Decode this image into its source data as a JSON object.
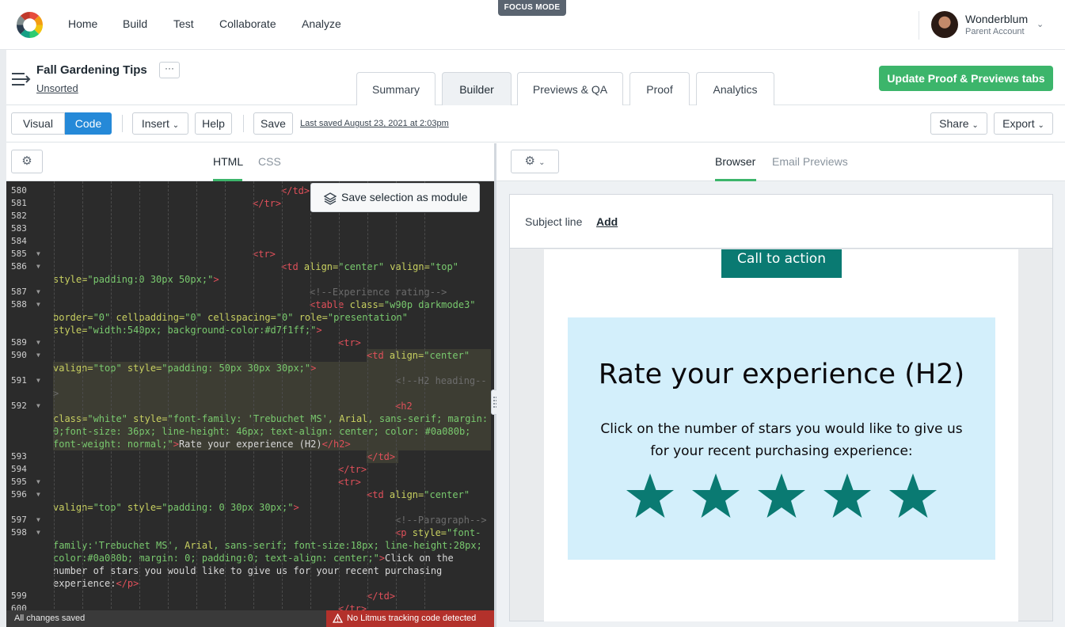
{
  "topnav": {
    "items": [
      "Home",
      "Build",
      "Test",
      "Collaborate",
      "Analyze"
    ],
    "focus_mode": "FOCUS MODE",
    "account": {
      "name": "Wonderblum",
      "role": "Parent Account"
    }
  },
  "project": {
    "title": "Fall Gardening Tips",
    "more_label": "···",
    "folder": "Unsorted",
    "tabs": [
      "Summary",
      "Builder",
      "Previews & QA",
      "Proof",
      "Analytics"
    ],
    "active_tab": "Builder",
    "update_button": "Update Proof & Previews tabs"
  },
  "toolbar": {
    "visual": "Visual",
    "code": "Code",
    "insert": "Insert",
    "help": "Help",
    "save": "Save",
    "last_saved": "Last saved August 23, 2021 at 2:03pm",
    "share": "Share",
    "export": "Export"
  },
  "editor": {
    "tabs": [
      "HTML",
      "CSS"
    ],
    "active_tab": "HTML",
    "save_selection": "Save selection as module",
    "status": "All changes saved",
    "warning": "No Litmus tracking code detected",
    "lines": [
      {
        "num": "580",
        "fold": false,
        "indent": 347,
        "segs": [
          {
            "c": "tg",
            "t": "</td>"
          }
        ]
      },
      {
        "num": "581",
        "fold": false,
        "indent": 311,
        "segs": [
          {
            "c": "tg",
            "t": "</tr>"
          }
        ]
      },
      {
        "num": "582",
        "fold": false,
        "indent": 0,
        "segs": []
      },
      {
        "num": "583",
        "fold": false,
        "indent": 0,
        "segs": []
      },
      {
        "num": "584",
        "fold": false,
        "indent": 0,
        "segs": []
      },
      {
        "num": "585",
        "fold": true,
        "indent": 311,
        "segs": [
          {
            "c": "tg",
            "t": "<tr>"
          }
        ]
      },
      {
        "num": "586",
        "fold": true,
        "indent": 347,
        "segs": [
          {
            "c": "tg",
            "t": "<td "
          },
          {
            "c": "at",
            "t": "align="
          },
          {
            "c": "sv",
            "t": "\"center\""
          },
          {
            "c": "at",
            "t": " valign="
          },
          {
            "c": "sv",
            "t": "\"top\""
          }
        ]
      },
      {
        "num": "",
        "fold": false,
        "indent": 59,
        "segs": [
          {
            "c": "at",
            "t": "style="
          },
          {
            "c": "sv",
            "t": "\"padding:0 30px 50px;\""
          },
          {
            "c": "tg",
            "t": ">"
          }
        ]
      },
      {
        "num": "587",
        "fold": true,
        "indent": 383,
        "segs": [
          {
            "c": "cm",
            "t": "<!--Experience rating-->"
          }
        ]
      },
      {
        "num": "588",
        "fold": true,
        "indent": 383,
        "segs": [
          {
            "c": "tg",
            "t": "<table "
          },
          {
            "c": "at",
            "t": "class="
          },
          {
            "c": "sv",
            "t": "\"w90p darkmode3\""
          }
        ]
      },
      {
        "num": "",
        "fold": false,
        "indent": 59,
        "segs": [
          {
            "c": "at",
            "t": "border="
          },
          {
            "c": "sv",
            "t": "\"0\""
          },
          {
            "c": "at",
            "t": " cellpadding="
          },
          {
            "c": "sv",
            "t": "\"0\""
          },
          {
            "c": "at",
            "t": " cellspacing="
          },
          {
            "c": "sv",
            "t": "\"0\""
          },
          {
            "c": "at",
            "t": " role="
          },
          {
            "c": "sv",
            "t": "\"presentation\""
          }
        ]
      },
      {
        "num": "",
        "fold": false,
        "indent": 59,
        "segs": [
          {
            "c": "at",
            "t": "style="
          },
          {
            "c": "sv",
            "t": "\"width:540px; background-color:#d7f1ff;\""
          },
          {
            "c": "tg",
            "t": ">"
          }
        ]
      },
      {
        "num": "589",
        "fold": true,
        "indent": 419,
        "segs": [
          {
            "c": "tg",
            "t": "<tr>"
          }
        ]
      },
      {
        "num": "590",
        "fold": true,
        "indent": 455,
        "segs": [
          {
            "c": "tg",
            "t": "<td "
          },
          {
            "c": "at",
            "t": "align="
          },
          {
            "c": "sv",
            "t": "\"center\""
          }
        ]
      },
      {
        "num": "",
        "fold": false,
        "indent": 59,
        "segs": [
          {
            "c": "at",
            "t": "valign="
          },
          {
            "c": "sv",
            "t": "\"top\""
          },
          {
            "c": "at",
            "t": " style="
          },
          {
            "c": "sv",
            "t": "\"padding: 50px 30px 30px;\""
          },
          {
            "c": "tg",
            "t": ">"
          }
        ]
      },
      {
        "num": "591",
        "fold": true,
        "indent": 491,
        "segs": [
          {
            "c": "cm",
            "t": "<!--H2 heading--"
          }
        ]
      },
      {
        "num": "",
        "fold": false,
        "indent": 59,
        "segs": [
          {
            "c": "cm",
            "t": ">"
          }
        ]
      },
      {
        "num": "592",
        "fold": true,
        "indent": 491,
        "segs": [
          {
            "c": "tg",
            "t": "<h2"
          }
        ]
      },
      {
        "num": "",
        "fold": false,
        "indent": 59,
        "segs": [
          {
            "c": "at",
            "t": "class="
          },
          {
            "c": "sv",
            "t": "\"white\""
          },
          {
            "c": "at",
            "t": " style="
          },
          {
            "c": "sv",
            "t": "\"font-family: 'Trebuchet MS', "
          },
          {
            "c": "at",
            "t": "Arial"
          },
          {
            "c": "sv",
            "t": ", sans-serif; margin:"
          }
        ]
      },
      {
        "num": "",
        "fold": false,
        "indent": 59,
        "segs": [
          {
            "c": "sv",
            "t": "0;font-size: 36px; line-height: 46px; text-align: center; color: #0a080b;"
          }
        ]
      },
      {
        "num": "",
        "fold": false,
        "indent": 59,
        "segs": [
          {
            "c": "sv",
            "t": "font-weight: normal;\""
          },
          {
            "c": "tg",
            "t": ">"
          },
          {
            "c": "tx",
            "t": "Rate your experience (H2)"
          },
          {
            "c": "tg",
            "t": "</h2>"
          }
        ]
      },
      {
        "num": "593",
        "fold": false,
        "indent": 455,
        "segs": [
          {
            "c": "tg",
            "t": "</td>"
          }
        ]
      },
      {
        "num": "594",
        "fold": false,
        "indent": 419,
        "segs": [
          {
            "c": "tg",
            "t": "</tr>"
          }
        ]
      },
      {
        "num": "595",
        "fold": true,
        "indent": 419,
        "segs": [
          {
            "c": "tg",
            "t": "<tr>"
          }
        ]
      },
      {
        "num": "596",
        "fold": true,
        "indent": 455,
        "segs": [
          {
            "c": "tg",
            "t": "<td "
          },
          {
            "c": "at",
            "t": "align="
          },
          {
            "c": "sv",
            "t": "\"center\""
          }
        ]
      },
      {
        "num": "",
        "fold": false,
        "indent": 59,
        "segs": [
          {
            "c": "at",
            "t": "valign="
          },
          {
            "c": "sv",
            "t": "\"top\""
          },
          {
            "c": "at",
            "t": " style="
          },
          {
            "c": "sv",
            "t": "\"padding: 0 30px 30px;\""
          },
          {
            "c": "tg",
            "t": ">"
          }
        ]
      },
      {
        "num": "597",
        "fold": true,
        "indent": 491,
        "segs": [
          {
            "c": "cm",
            "t": "<!--Paragraph-->"
          }
        ]
      },
      {
        "num": "598",
        "fold": true,
        "indent": 491,
        "segs": [
          {
            "c": "tg",
            "t": "<p "
          },
          {
            "c": "at",
            "t": "style="
          },
          {
            "c": "sv",
            "t": "\"font-"
          }
        ]
      },
      {
        "num": "",
        "fold": false,
        "indent": 59,
        "segs": [
          {
            "c": "sv",
            "t": "family:'Trebuchet MS', "
          },
          {
            "c": "at",
            "t": "Arial"
          },
          {
            "c": "sv",
            "t": ", sans-serif; font-size:18px; line-height:28px;"
          }
        ]
      },
      {
        "num": "",
        "fold": false,
        "indent": 59,
        "segs": [
          {
            "c": "sv",
            "t": "color:#0a080b; margin: 0; padding:0; text-align: center;\""
          },
          {
            "c": "tg",
            "t": ">"
          },
          {
            "c": "tx",
            "t": "Click on the"
          }
        ]
      },
      {
        "num": "",
        "fold": false,
        "indent": 59,
        "segs": [
          {
            "c": "tx",
            "t": "number of stars you would like to give us for your recent purchasing"
          }
        ]
      },
      {
        "num": "",
        "fold": false,
        "indent": 59,
        "segs": [
          {
            "c": "tx",
            "t": "experience:"
          },
          {
            "c": "tg",
            "t": "</p>"
          }
        ]
      },
      {
        "num": "599",
        "fold": false,
        "indent": 455,
        "segs": [
          {
            "c": "tg",
            "t": "</td>"
          }
        ]
      },
      {
        "num": "600",
        "fold": false,
        "indent": 419,
        "segs": [
          {
            "c": "tg",
            "t": "</tr>"
          }
        ]
      }
    ]
  },
  "preview": {
    "tabs": [
      "Browser",
      "Email Previews"
    ],
    "active_tab": "Browser",
    "subject_label": "Subject line",
    "subject_add": "Add",
    "cta": "Call to action",
    "rating_heading": "Rate your experience (H2)",
    "rating_text": "Click on the number of stars you would like to give us for your recent purchasing experience:",
    "star_count": 5,
    "colors": {
      "star": "#0a7a72",
      "cta": "#0a7a72",
      "rating_bg": "#d3effb"
    }
  },
  "icons": [
    "logo-icon",
    "menu-collapse-icon",
    "gear-icon",
    "chevron-down-icon",
    "layers-icon",
    "warning-icon",
    "star-icon"
  ],
  "colors": {
    "accent_green": "#3cb56b",
    "accent_blue": "#2589d8",
    "warning": "#b3312b"
  }
}
